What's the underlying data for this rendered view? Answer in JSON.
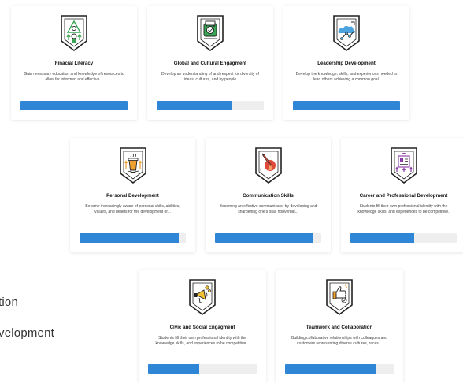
{
  "background_text": [
    "tion",
    "velopment"
  ],
  "colors": {
    "progress_fill": "#2f86d6",
    "progress_track": "#eeeeee",
    "badge_green": "#3aa655",
    "badge_blue": "#4aa3df",
    "badge_orange": "#f0a030",
    "badge_red": "#e04a3a",
    "badge_purple": "#8a3aa6",
    "badge_yellow": "#f2c230"
  },
  "cards": [
    {
      "title": "Finacial Literacy",
      "description": "Gain necessary education and knowledge of resources to allow for informed and effective...",
      "icon": "financial-badge-icon",
      "progress": 1.0
    },
    {
      "title": "Global and Cultural Engagment",
      "description": "Develop an understanding of and respect for diversity of ideas, cultures, and by people",
      "icon": "global-badge-icon",
      "progress": 0.7
    },
    {
      "title": "Leadership Development",
      "description": "Develop the knowledge, skills, and experiences needed to lead others achieving a common goal.",
      "icon": "leadership-badge-icon",
      "progress": 1.0
    },
    {
      "title": "Personal Development",
      "description": "Become increasingly aware of personal skills, abilities, values, and beliefs for the development of...",
      "icon": "personal-badge-icon",
      "progress": 0.93
    },
    {
      "title": "Communication Skills",
      "description": "Becoming an effective communicator by developing and sharpening one's oral, nonverbal...",
      "icon": "communication-badge-icon",
      "progress": 0.92
    },
    {
      "title": "Career and Professional Development",
      "description": "Students fill their own professional identity with the knowledge skills, and experiences to be competitive.",
      "icon": "career-badge-icon",
      "progress": 0.6
    },
    {
      "title": "Civic and Social Engagment",
      "description": "Students fill their own professional identity with the knowledge skills, and experiences to be competitive...",
      "icon": "civic-badge-icon",
      "progress": 0.47
    },
    {
      "title": "Teamwork and Collaboration",
      "description": "Building collaborative relationships with colleagues and customers representing diverse cultures, races...",
      "icon": "teamwork-badge-icon",
      "progress": 0.83
    }
  ]
}
